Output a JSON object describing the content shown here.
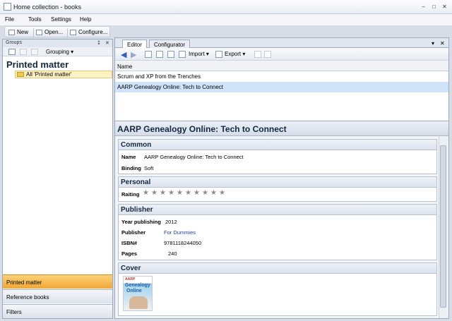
{
  "window": {
    "title": "Home collection - books",
    "min": "–",
    "max": "□",
    "close": "✕"
  },
  "menu": [
    "File",
    "Tools",
    "Settings",
    "Help"
  ],
  "toolbar": {
    "new": "New",
    "open": "Open...",
    "configure": "Configure..."
  },
  "groups": {
    "header": "Groups",
    "pin": "↧",
    "close": "✕",
    "grouping": "Grouping",
    "grouping_arrow": "▾",
    "title": "Printed matter",
    "tree_item": "All 'Printed matter'"
  },
  "nav": [
    "Printed matter",
    "Reference books",
    "Filters"
  ],
  "tabs": {
    "editor": "Editor",
    "configurator": "Configurator",
    "dropdown": "▾",
    "close": "✕"
  },
  "editor_toolbar": {
    "import": "Import",
    "export": "Export",
    "arrow": "▾"
  },
  "list": {
    "column": "Name",
    "rows": [
      "Scrum and XP from the Trenches",
      "AARP Genealogy Online: Tech to Connect"
    ],
    "selected": 1
  },
  "detail": {
    "title": "AARP Genealogy Online: Tech to Connect",
    "common": {
      "header": "Common",
      "name_label": "Name",
      "name_value": "AARP Genealogy Online: Tech to Connect",
      "binding_label": "Binding",
      "binding_value": "Soft"
    },
    "personal": {
      "header": "Personal",
      "rating_label": "Raiting",
      "stars_total": 10,
      "stars_filled": 0,
      "star_char": "★"
    },
    "publisher": {
      "header": "Publisher",
      "year_label": "Year publishing",
      "year_value": "2012",
      "publisher_label": "Publisher",
      "publisher_value": "For Dummies",
      "isbn_label": "ISBN#",
      "isbn_value": "9781118244050",
      "pages_label": "Pages",
      "pages_value": "240"
    },
    "cover": {
      "header": "Cover",
      "brand": "AARP",
      "line1": "Genealogy",
      "line2": "Online"
    }
  },
  "colors": {
    "accent": "#f3a632",
    "link": "#1b3fa8",
    "selection": "#cfe4f8"
  }
}
